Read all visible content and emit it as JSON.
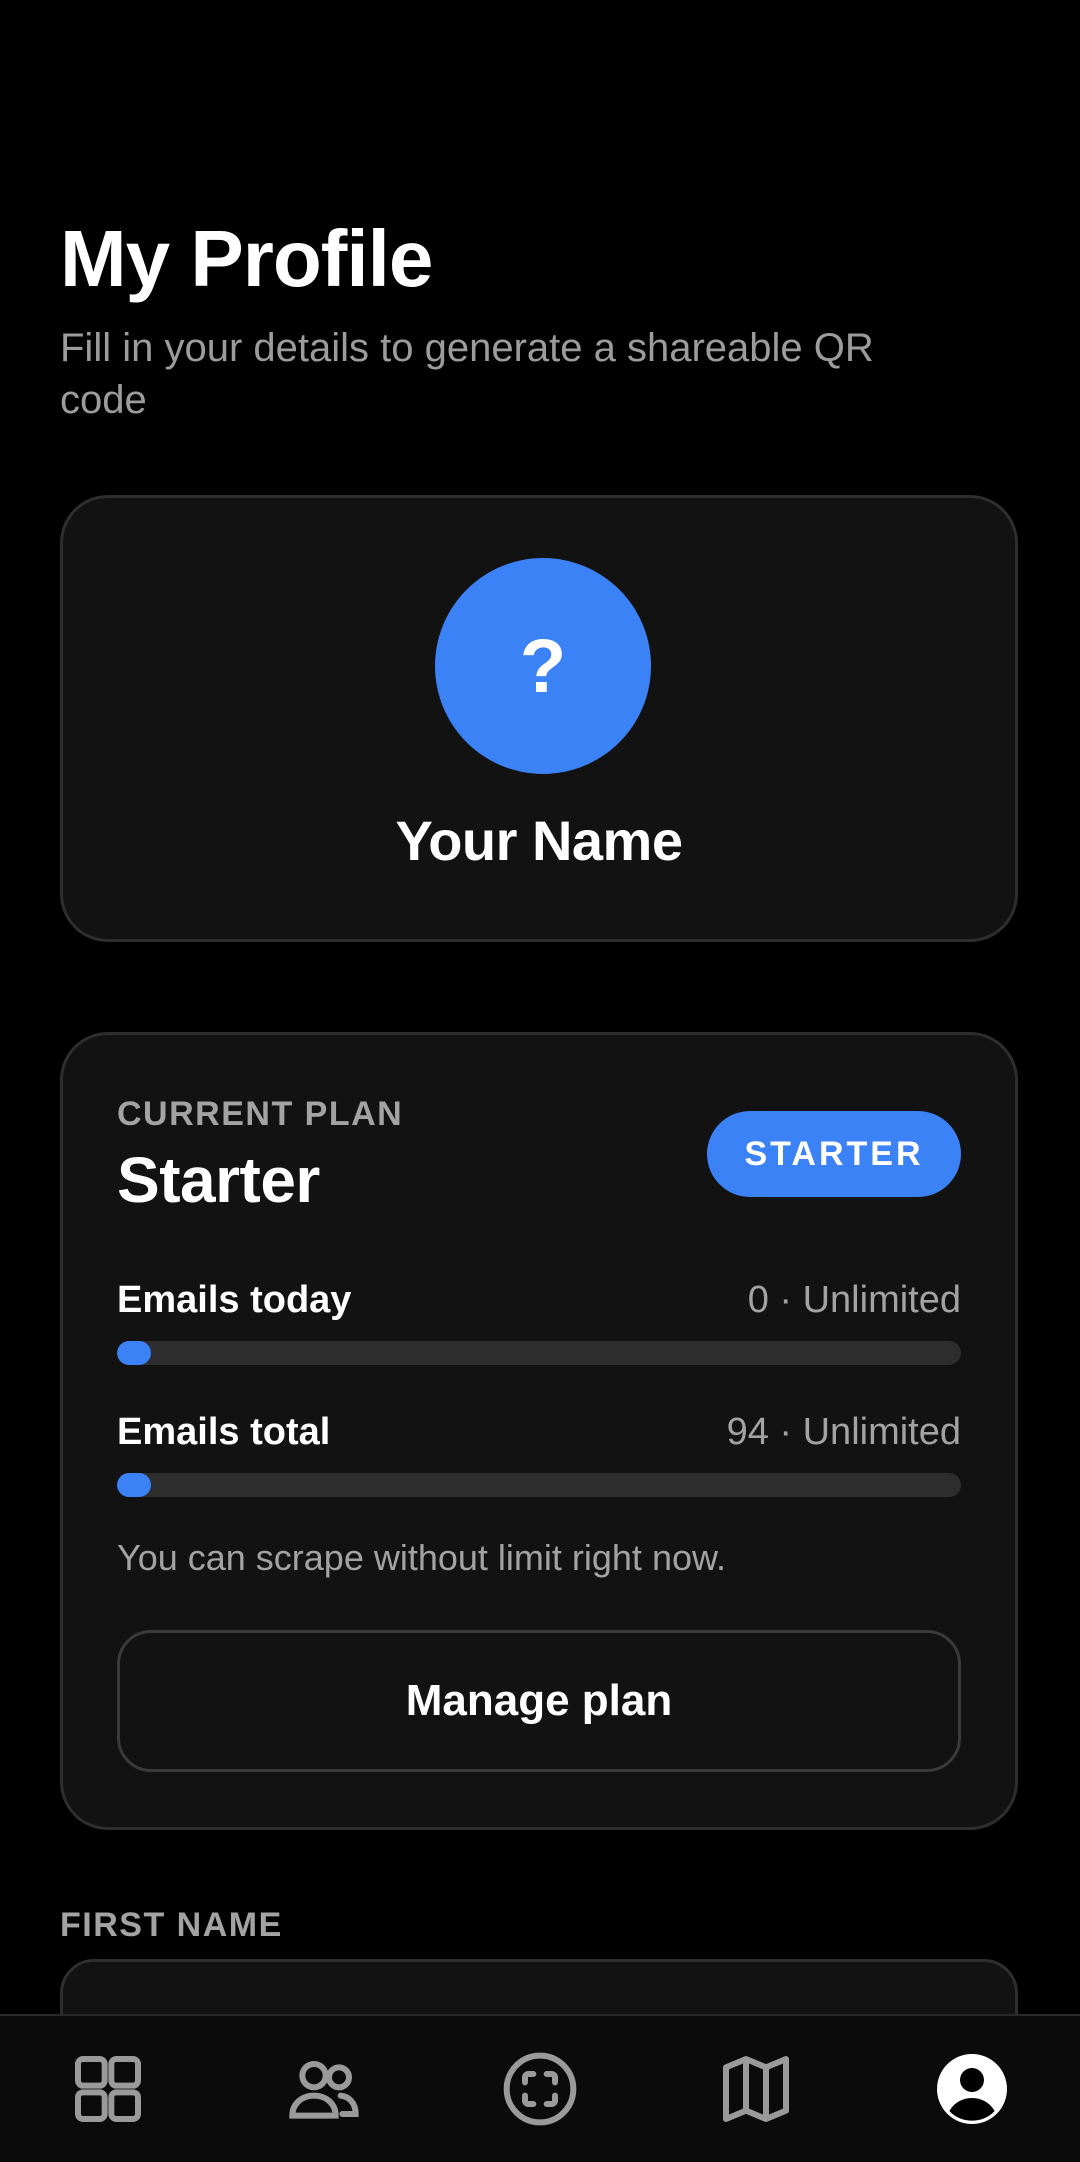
{
  "header": {
    "title": "My Profile",
    "subtitle": "Fill in your details to generate a shareable QR code"
  },
  "profile_card": {
    "avatar_text": "?",
    "name": "Your Name"
  },
  "plan_card": {
    "eyebrow": "CURRENT PLAN",
    "plan_name": "Starter",
    "badge": "STARTER",
    "usage": [
      {
        "label": "Emails today",
        "value": "0 · Unlimited",
        "progress_fraction": 0
      },
      {
        "label": "Emails total",
        "value": "94 · Unlimited",
        "progress_fraction": 0
      }
    ],
    "note": "You can scrape without limit right now.",
    "manage_button": "Manage plan"
  },
  "form": {
    "first_name_label": "FIRST NAME",
    "first_name_value": ""
  },
  "bottom_nav": {
    "items": [
      {
        "icon": "grid-icon",
        "active": false
      },
      {
        "icon": "users-icon",
        "active": false
      },
      {
        "icon": "scan-icon",
        "active": false
      },
      {
        "icon": "map-icon",
        "active": false
      },
      {
        "icon": "profile-icon",
        "active": true
      }
    ]
  },
  "colors": {
    "accent": "#3b82f6",
    "background": "#000000",
    "card": "#121212",
    "muted_text": "#a3a3a3"
  }
}
